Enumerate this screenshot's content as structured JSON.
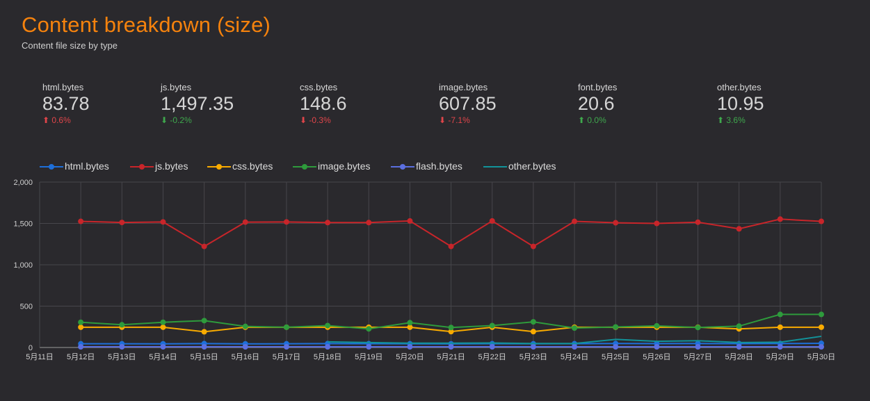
{
  "header": {
    "title": "Content breakdown (size)",
    "subtitle": "Content file size by type"
  },
  "metrics": [
    {
      "label": "html.bytes",
      "value": "83.78",
      "delta": "0.6%",
      "direction": "up",
      "arrow": "⬆",
      "color": "#e0454a"
    },
    {
      "label": "js.bytes",
      "value": "1,497.35",
      "delta": "-0.2%",
      "direction": "down",
      "arrow": "⬇",
      "color": "#3fa84d"
    },
    {
      "label": "css.bytes",
      "value": "148.6",
      "delta": "-0.3%",
      "direction": "down",
      "arrow": "⬇",
      "color": "#e0454a"
    },
    {
      "label": "image.bytes",
      "value": "607.85",
      "delta": "-7.1%",
      "direction": "down",
      "arrow": "⬇",
      "color": "#e0454a"
    },
    {
      "label": "font.bytes",
      "value": "20.6",
      "delta": "0.0%",
      "direction": "up",
      "arrow": "⬆",
      "color": "#3fa84d"
    },
    {
      "label": "other.bytes",
      "value": "10.95",
      "delta": "3.6%",
      "direction": "up",
      "arrow": "⬆",
      "color": "#3fa84d"
    }
  ],
  "chart_data": {
    "type": "line",
    "x": [
      "5月11日",
      "5月12日",
      "5月13日",
      "5月14日",
      "5月15日",
      "5月16日",
      "5月17日",
      "5月18日",
      "5月19日",
      "5月20日",
      "5月21日",
      "5月22日",
      "5月23日",
      "5月24日",
      "5月25日",
      "5月26日",
      "5月27日",
      "5月28日",
      "5月29日",
      "5月30日"
    ],
    "ylim": [
      0,
      2000
    ],
    "yticks": [
      0,
      500,
      1000,
      1500,
      2000
    ],
    "ytick_labels": [
      "0",
      "500",
      "1,000",
      "1,500",
      "2,000"
    ],
    "grid": true,
    "legend_position": "top-left",
    "series": [
      {
        "name": "html.bytes",
        "color": "#1e6fd9",
        "values": [
          null,
          45,
          45,
          44,
          47,
          44,
          45,
          47,
          46,
          45,
          44,
          46,
          45,
          46,
          48,
          47,
          48,
          47,
          48,
          50
        ]
      },
      {
        "name": "js.bytes",
        "color": "#c8252a",
        "values": [
          null,
          1525,
          1512,
          1518,
          1222,
          1516,
          1518,
          1510,
          1510,
          1530,
          1222,
          1530,
          1222,
          1525,
          1508,
          1500,
          1515,
          1435,
          1552,
          1525
        ]
      },
      {
        "name": "css.bytes",
        "color": "#f9ab00",
        "values": [
          null,
          245,
          245,
          245,
          190,
          245,
          245,
          245,
          245,
          245,
          192,
          245,
          192,
          245,
          245,
          245,
          245,
          225,
          245,
          245
        ]
      },
      {
        "name": "image.bytes",
        "color": "#2e9b3c",
        "values": [
          null,
          305,
          275,
          305,
          325,
          255,
          245,
          265,
          225,
          300,
          242,
          265,
          310,
          235,
          248,
          262,
          242,
          258,
          400,
          400
        ]
      },
      {
        "name": "flash.bytes",
        "color": "#5b6fe0",
        "values": [
          null,
          8,
          8,
          8,
          8,
          8,
          8,
          8,
          8,
          8,
          8,
          8,
          8,
          8,
          8,
          8,
          8,
          8,
          8,
          8
        ]
      },
      {
        "name": "other.bytes",
        "color": "#12939a",
        "values": [
          null,
          null,
          null,
          null,
          null,
          null,
          null,
          68,
          60,
          52,
          52,
          55,
          48,
          48,
          98,
          75,
          82,
          60,
          64,
          135
        ]
      }
    ]
  }
}
